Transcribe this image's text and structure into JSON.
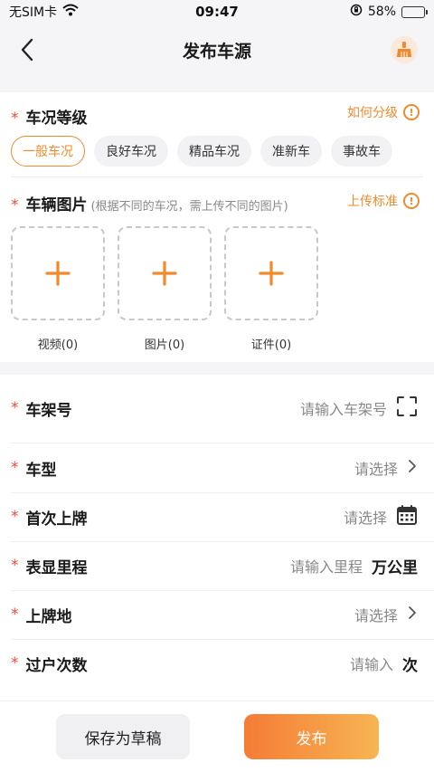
{
  "status_bar": {
    "carrier": "无SIM卡",
    "time": "09:47",
    "battery": "58%",
    "battery_level": 0.58
  },
  "nav": {
    "title": "发布车源"
  },
  "condition": {
    "required_mark": "*",
    "title": "车况等级",
    "help_link": "如何分级",
    "options": [
      "一般车况",
      "良好车况",
      "精品车况",
      "准新车",
      "事故车"
    ],
    "selected_index": 0
  },
  "photos": {
    "required_mark": "*",
    "title": "车辆图片",
    "hint": "(根据不同的车况，需上传不同的图片)",
    "help_link": "上传标准",
    "slots": [
      {
        "label": "视频(0)"
      },
      {
        "label": "图片(0)"
      },
      {
        "label": "证件(0)"
      }
    ]
  },
  "form": {
    "rows": [
      {
        "label": "车架号",
        "placeholder": "请输入车架号",
        "icon": "scan-icon"
      },
      {
        "label": "车型",
        "placeholder": "请选择",
        "icon": "chevron-right-icon"
      },
      {
        "label": "首次上牌",
        "placeholder": "请选择",
        "icon": "calendar-icon"
      },
      {
        "label": "表显里程",
        "placeholder": "请输入里程",
        "unit": "万公里"
      },
      {
        "label": "上牌地",
        "placeholder": "请选择",
        "icon": "chevron-right-icon"
      },
      {
        "label": "过户次数",
        "placeholder": "请输入",
        "unit": "次"
      }
    ]
  },
  "footer": {
    "draft_label": "保存为草稿",
    "publish_label": "发布"
  },
  "colors": {
    "accent": "#f08a2c",
    "required": "#f04b3c",
    "battery": "#3cc13b"
  }
}
